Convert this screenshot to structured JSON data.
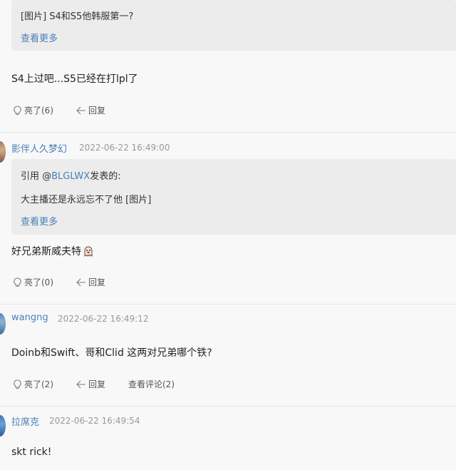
{
  "posts": [
    {
      "quote_text": "[图片] S4和S5他韩服第一?",
      "more": "查看更多",
      "content": "S4上过吧...S5已经在打lpl了",
      "like": "亮了(6)",
      "reply": "回复"
    },
    {
      "author": "影伴人久梦幻",
      "time": "2022-06-22 16:49:00",
      "quote_prefix": "引用 @",
      "quote_user": "BLGLWX",
      "quote_suffix": "发表的:",
      "quote_text": "大主播还是永远忘不了他 [图片]",
      "more": "查看更多",
      "content": "好兄弟斯威夫特",
      "like": "亮了(0)",
      "reply": "回复"
    },
    {
      "author": "wangng",
      "time": "2022-06-22 16:49:12",
      "content": "Doinb和Swift、哥和Clid 这两对兄弟哪个铁?",
      "like": "亮了(2)",
      "reply": "回复",
      "comments": "查看评论(2)"
    },
    {
      "author": "拉席克",
      "time": "2022-06-22 16:49:54",
      "content": "skt rick!"
    }
  ],
  "icons": {
    "like": "bulb-like-icon",
    "reply": "reply-arrow-icon",
    "emoji": "ghost-emoji-icon"
  },
  "colors": {
    "link": "#4a7fb8",
    "quote_bg": "#ececec",
    "time": "#999999"
  }
}
